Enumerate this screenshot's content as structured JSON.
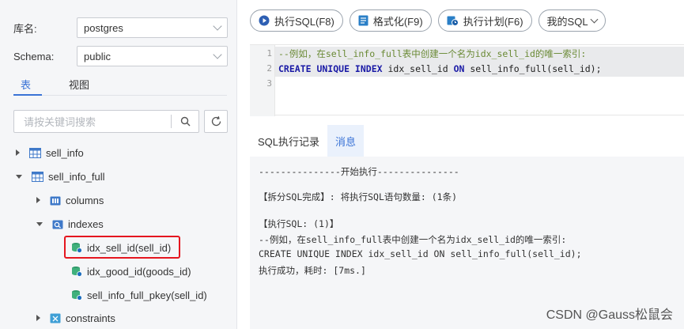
{
  "sidebar": {
    "db_label": "库名:",
    "db_value": "postgres",
    "schema_label": "Schema:",
    "schema_value": "public",
    "tabs": [
      {
        "label": "表"
      },
      {
        "label": "视图"
      }
    ],
    "search_placeholder": "请按关键词搜索",
    "tree": [
      {
        "label": "sell_info"
      },
      {
        "label": "sell_info_full"
      },
      {
        "label": "columns"
      },
      {
        "label": "indexes"
      },
      {
        "label": "idx_sell_id(sell_id)"
      },
      {
        "label": "idx_good_id(goods_id)"
      },
      {
        "label": "sell_info_full_pkey(sell_id)"
      },
      {
        "label": "constraints"
      }
    ]
  },
  "toolbar": {
    "run": "执行SQL(F8)",
    "format": "格式化(F9)",
    "plan": "执行计划(F6)",
    "mysql": "我的SQL"
  },
  "editor": {
    "line_numbers": [
      "1",
      "2",
      "3"
    ],
    "line1": "--例如，在sell_info_full表中创建一个名为idx_sell_id的唯一索引:",
    "line2": {
      "kw1": "CREATE UNIQUE INDEX",
      "id1": " idx_sell_id ",
      "kw2": "ON",
      "id2": " sell_info_full(sell_id);"
    }
  },
  "bottom": {
    "tabs": [
      {
        "label": "SQL执行记录"
      },
      {
        "label": "消息"
      }
    ],
    "active_tab": "消息",
    "lines": [
      "---------------开始执行---------------",
      "【拆分SQL完成】: 将执行SQL语句数量: (1条)",
      "【执行SQL: (1)】",
      "--例如，在sell_info_full表中创建一个名为idx_sell_id的唯一索引:",
      "CREATE UNIQUE INDEX idx_sell_id ON sell_info_full(sell_id);",
      "执行成功，耗时: [7ms.]"
    ]
  },
  "watermark": "CSDN @Gauss松鼠会",
  "colors": {
    "accent": "#3a73d6",
    "highlight": "#e5161f"
  }
}
